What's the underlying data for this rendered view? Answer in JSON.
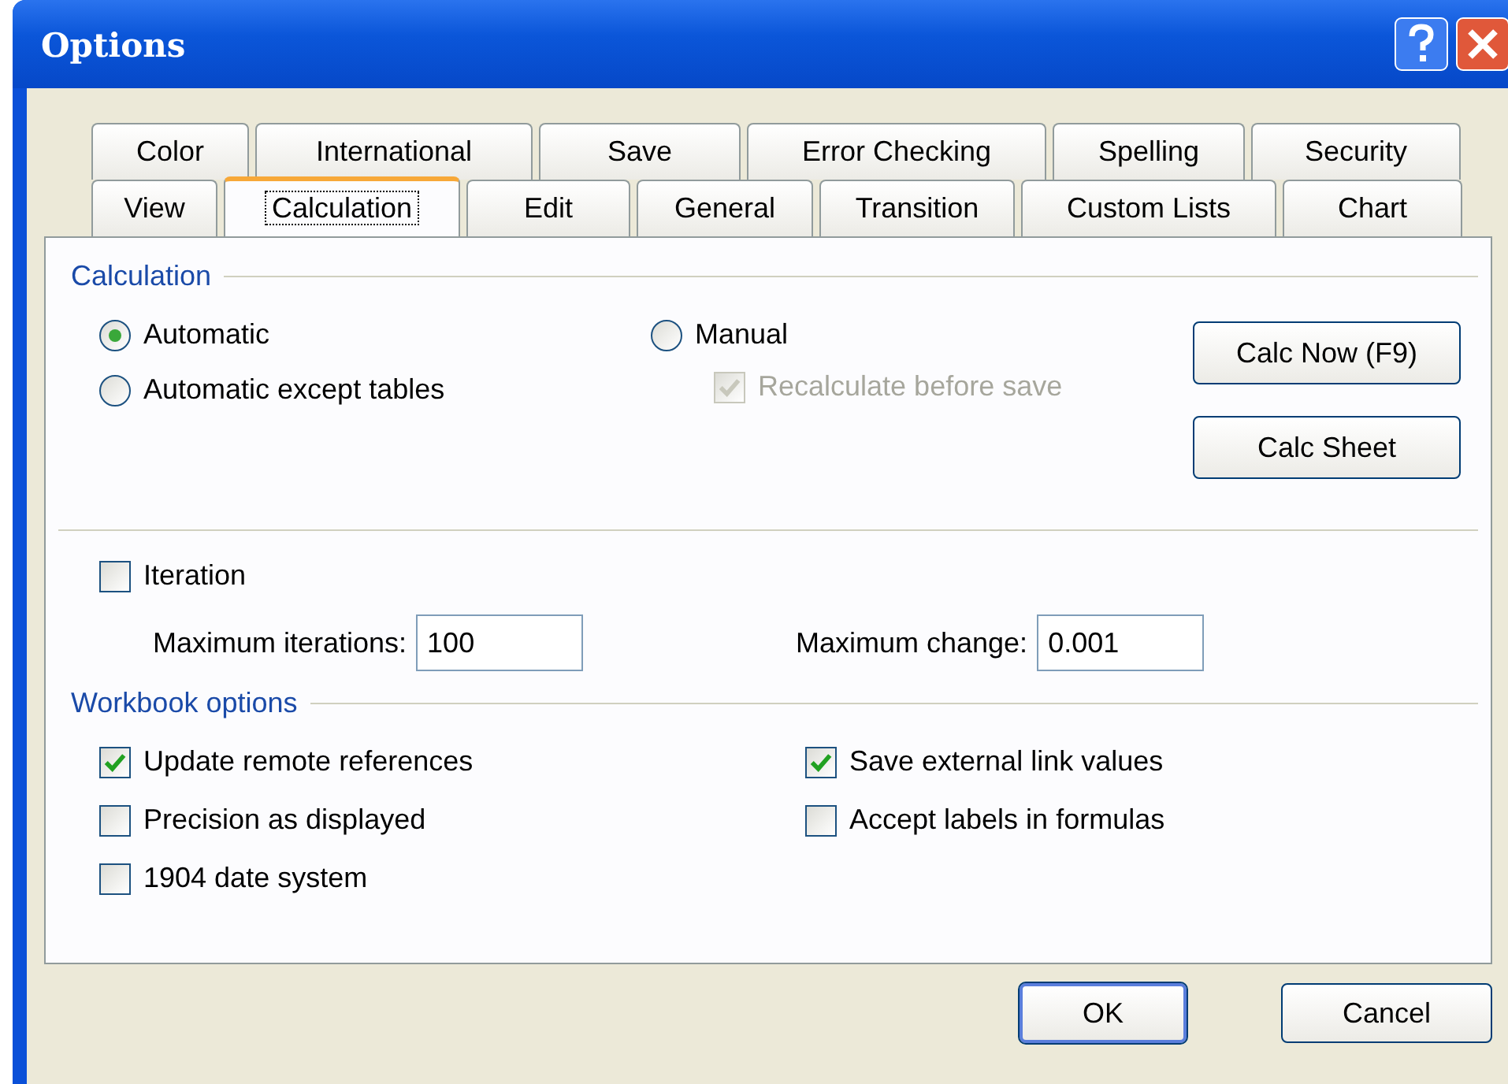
{
  "window": {
    "title": "Options"
  },
  "tabs": [
    [
      {
        "label": "Color",
        "selected": false
      },
      {
        "label": "International",
        "selected": false
      },
      {
        "label": "Save",
        "selected": false
      },
      {
        "label": "Error Checking",
        "selected": false
      },
      {
        "label": "Spelling",
        "selected": false
      },
      {
        "label": "Security",
        "selected": false
      }
    ],
    [
      {
        "label": "View",
        "selected": false
      },
      {
        "label": "Calculation",
        "selected": true
      },
      {
        "label": "Edit",
        "selected": false
      },
      {
        "label": "General",
        "selected": false
      },
      {
        "label": "Transition",
        "selected": false
      },
      {
        "label": "Custom Lists",
        "selected": false
      },
      {
        "label": "Chart",
        "selected": false
      }
    ]
  ],
  "calculation": {
    "heading": "Calculation",
    "columns": [
      [
        {
          "label": "Automatic",
          "selected": true
        },
        {
          "label": "Automatic except tables",
          "selected": false
        }
      ],
      [
        {
          "label": "Manual",
          "selected": false
        }
      ]
    ],
    "recalc": {
      "label": "Recalculate before save",
      "checked": true,
      "disabled": true
    },
    "buttons": [
      "Calc Now (F9)",
      "Calc Sheet"
    ]
  },
  "iteration": {
    "label": "Iteration",
    "checked": false,
    "fields": [
      {
        "label": "Maximum iterations:",
        "value": "100"
      },
      {
        "label": "Maximum change:",
        "value": "0.001"
      }
    ]
  },
  "workbook": {
    "heading": "Workbook options",
    "options": [
      {
        "label": "Update remote references",
        "checked": true
      },
      {
        "label": "Save external link values",
        "checked": true
      },
      {
        "label": "Precision as displayed",
        "checked": false
      },
      {
        "label": "Accept labels in formulas",
        "checked": false
      },
      {
        "label": "1904 date system",
        "checked": false
      }
    ]
  },
  "buttons": [
    {
      "label": "OK",
      "default": true
    },
    {
      "label": "Cancel",
      "default": false
    }
  ]
}
